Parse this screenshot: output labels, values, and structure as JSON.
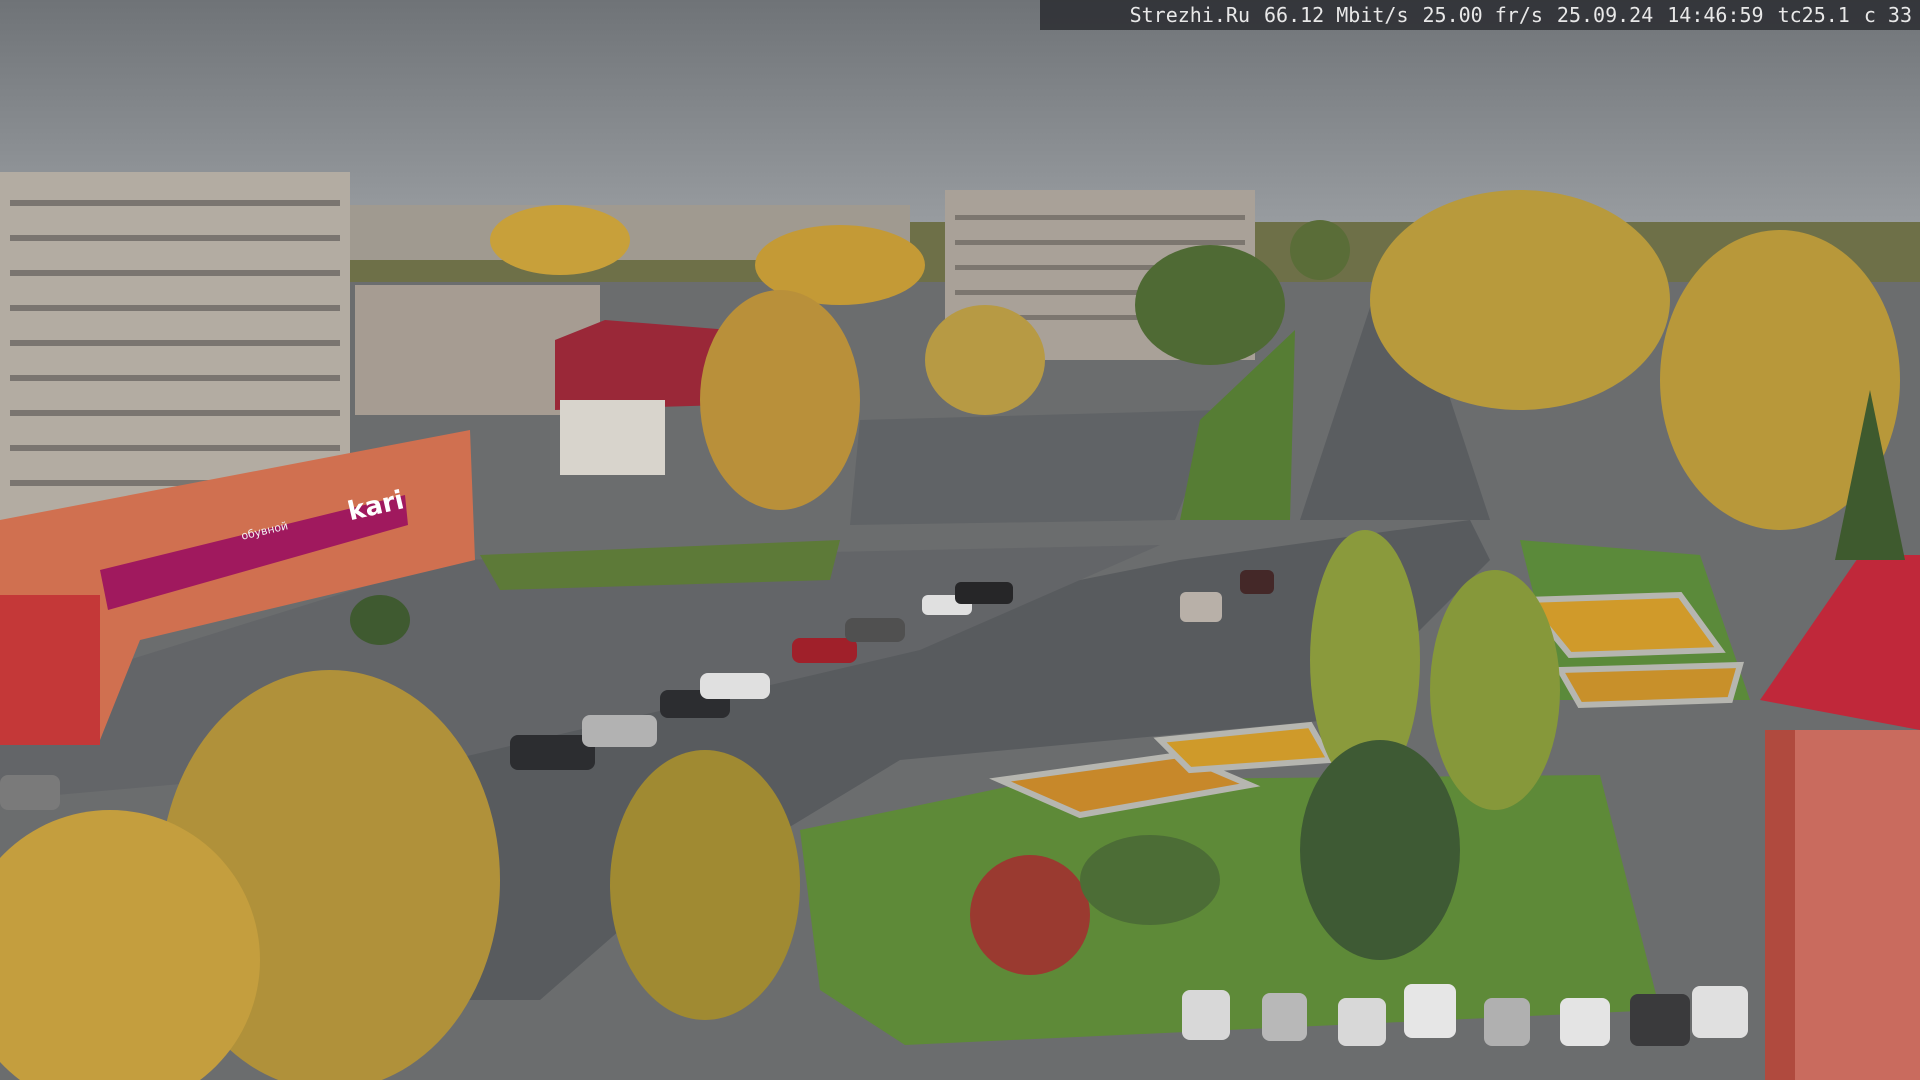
{
  "overlay": {
    "site": "Strezhi.Ru",
    "bitrate": "66.12 Mbit/s",
    "framerate": "25.00 fr/s",
    "date": "25.09.24",
    "time": "14:46:59",
    "camera_code": "tc25.1",
    "channel": "c 33"
  },
  "signage": {
    "store_brand": "kari",
    "store_slogan": "обувной"
  },
  "colors": {
    "sky": "#868b90",
    "asphalt": "#5c5f62",
    "grass": "#5f8a3a",
    "autumn_foliage": "#c8a03a",
    "kari_magenta": "#a0195e",
    "roof_red": "#c0283a",
    "overlay_bg": "#2a2c30"
  }
}
